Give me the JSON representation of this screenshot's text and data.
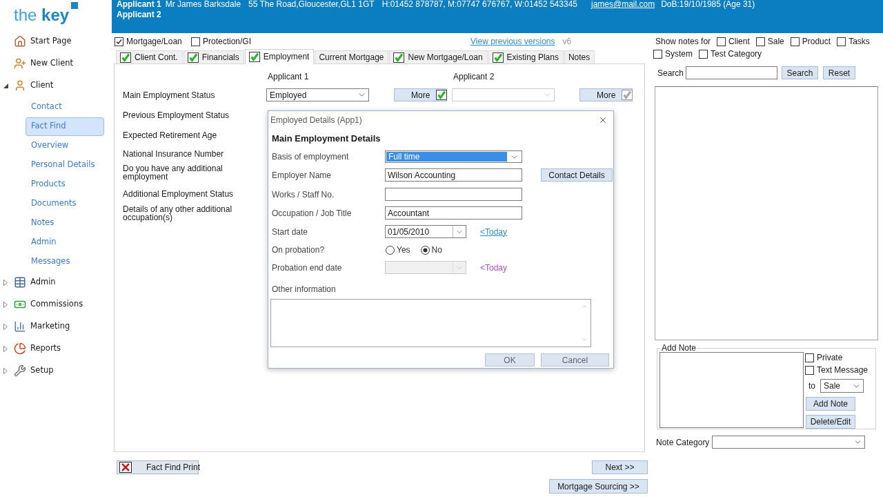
{
  "logo": {
    "prefix": "the",
    "name": "key"
  },
  "header": {
    "applicants": [
      {
        "label": "Applicant 1",
        "name": "Mr James Barksdale",
        "address": "55 The Road,Gloucester,GL1 1GT",
        "phones": "H:01452 878787, M:07747 676767, W:01452 543345",
        "email": "james@mail.com",
        "dob": "DoB:19/10/1985 (Age 31)"
      },
      {
        "label": "Applicant 2"
      }
    ]
  },
  "sidebar": {
    "items": [
      {
        "label": "Start Page",
        "kind": "link"
      },
      {
        "label": "New Client",
        "kind": "link"
      },
      {
        "label": "Client",
        "kind": "group",
        "expanded": true,
        "children": [
          {
            "label": "Contact",
            "selected": false
          },
          {
            "label": "Fact Find",
            "selected": true
          },
          {
            "label": "Overview",
            "selected": false
          },
          {
            "label": "Personal Details",
            "selected": false
          },
          {
            "label": "Products",
            "selected": false
          },
          {
            "label": "Documents",
            "selected": false
          },
          {
            "label": "Notes",
            "selected": false
          },
          {
            "label": "Admin",
            "selected": false
          },
          {
            "label": "Messages",
            "selected": false
          }
        ]
      },
      {
        "label": "Admin",
        "kind": "group",
        "expanded": false
      },
      {
        "label": "Commissions",
        "kind": "group",
        "expanded": false
      },
      {
        "label": "Marketing",
        "kind": "group",
        "expanded": false
      },
      {
        "label": "Reports",
        "kind": "group",
        "expanded": false
      },
      {
        "label": "Setup",
        "kind": "group",
        "expanded": false
      }
    ]
  },
  "product_filters": [
    {
      "label": "Mortgage/Loan",
      "checked": true
    },
    {
      "label": "Protection/GI",
      "checked": false
    }
  ],
  "versions": {
    "link": "View previous versions",
    "version": "v6"
  },
  "tabs": [
    {
      "label": "Client Cont.",
      "complete": true,
      "selected": false
    },
    {
      "label": "Financials",
      "complete": true,
      "selected": false
    },
    {
      "label": "Employment",
      "complete": true,
      "selected": true
    },
    {
      "label": "Current Mortgage",
      "complete": false,
      "selected": false
    },
    {
      "label": "New Mortgage/Loan",
      "complete": true,
      "selected": false
    },
    {
      "label": "Existing Plans",
      "complete": true,
      "selected": false
    },
    {
      "label": "Notes",
      "complete": false,
      "selected": false
    }
  ],
  "form": {
    "columns": [
      "Applicant 1",
      "Applicant 2"
    ],
    "rows": [
      {
        "label": "Main Employment Status",
        "controls": [
          {
            "value": "Employed",
            "more": "More",
            "disabled": false
          },
          {
            "more": "More",
            "disabled": true
          }
        ]
      },
      {
        "label": "Previous Employment Status"
      },
      {
        "label": "Expected Retirement Age"
      },
      {
        "label": "National Insurance Number"
      },
      {
        "label": "Do you have any additional employment"
      },
      {
        "label": "Additional Employment Status"
      },
      {
        "label": "Details of any other additional occupation(s)"
      }
    ]
  },
  "dialog": {
    "title": "Employed Details (App1)",
    "heading": "Main Employment Details",
    "fields": [
      {
        "kind": "select",
        "label": "Basis of employment",
        "value": "Full time",
        "focused": true
      },
      {
        "kind": "text",
        "label": "Employer Name",
        "value": "Wilson Accounting",
        "button": "Contact Details"
      },
      {
        "kind": "text",
        "label": "Works / Staff No."
      },
      {
        "kind": "text",
        "label": "Occupation / Job Title",
        "value": "Accountant"
      },
      {
        "kind": "date",
        "label": "Start date",
        "value": "01/05/2010",
        "link": "<Today",
        "disabled": false
      },
      {
        "kind": "radio",
        "label": "On probation?",
        "options": [
          {
            "label": "Yes",
            "selected": false
          },
          {
            "label": "No",
            "selected": true
          }
        ]
      },
      {
        "kind": "date",
        "label": "Probation end date",
        "link": "<Today",
        "disabled": true
      },
      {
        "kind": "textarea",
        "label": "Other information"
      }
    ],
    "buttons": [
      "OK",
      "Cancel"
    ]
  },
  "footer": {
    "print_button": "Fact Find Print",
    "next_button": "Next >>",
    "sourcing_button": "Mortgage Sourcing >>"
  },
  "notes_panel": {
    "show_label": "Show notes for",
    "filters": [
      {
        "label": "Client",
        "checked": false
      },
      {
        "label": "Sale",
        "checked": false
      },
      {
        "label": "Product",
        "checked": false
      },
      {
        "label": "Tasks",
        "checked": false
      },
      {
        "label": "System",
        "checked": false
      },
      {
        "label": "Test Category",
        "checked": false
      }
    ],
    "search": {
      "label": "Search",
      "button": "Search",
      "reset": "Reset"
    },
    "add_note": {
      "title": "Add Note",
      "options": [
        {
          "label": "Private",
          "checked": false
        },
        {
          "label": "Text Message",
          "checked": false
        }
      ],
      "to_label": "to",
      "to_value": "Sale",
      "add_button": "Add Note",
      "delete_button": "Delete/Edit"
    },
    "category": {
      "label": "Note Category"
    }
  }
}
